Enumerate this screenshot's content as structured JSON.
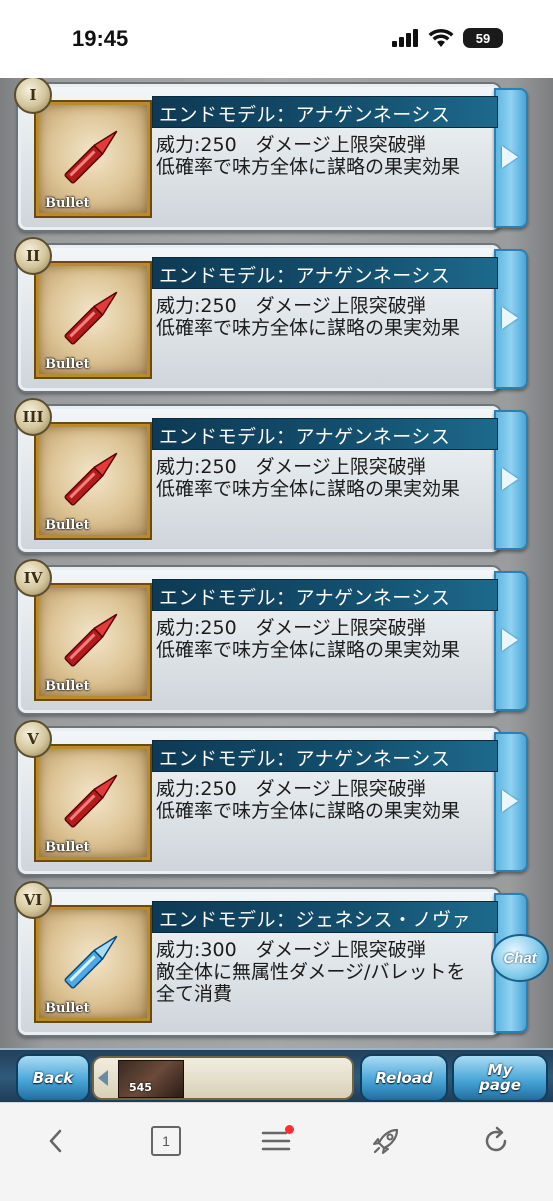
{
  "status_bar": {
    "time": "19:45",
    "battery": "59"
  },
  "cards": [
    {
      "numeral": "I",
      "name": "エンドモデル：アナゲンネーシス",
      "line1": "威力:250　ダメージ上限突破弾",
      "line2": "低確率で味方全体に謀略の果実効果",
      "line3": "",
      "item_label": "Bullet",
      "bullet_color": "red"
    },
    {
      "numeral": "II",
      "name": "エンドモデル：アナゲンネーシス",
      "line1": "威力:250　ダメージ上限突破弾",
      "line2": "低確率で味方全体に謀略の果実効果",
      "line3": "",
      "item_label": "Bullet",
      "bullet_color": "red"
    },
    {
      "numeral": "III",
      "name": "エンドモデル：アナゲンネーシス",
      "line1": "威力:250　ダメージ上限突破弾",
      "line2": "低確率で味方全体に謀略の果実効果",
      "line3": "",
      "item_label": "Bullet",
      "bullet_color": "red"
    },
    {
      "numeral": "IV",
      "name": "エンドモデル：アナゲンネーシス",
      "line1": "威力:250　ダメージ上限突破弾",
      "line2": "低確率で味方全体に謀略の果実効果",
      "line3": "",
      "item_label": "Bullet",
      "bullet_color": "red"
    },
    {
      "numeral": "V",
      "name": "エンドモデル：アナゲンネーシス",
      "line1": "威力:250　ダメージ上限突破弾",
      "line2": "低確率で味方全体に謀略の果実効果",
      "line3": "",
      "item_label": "Bullet",
      "bullet_color": "red"
    },
    {
      "numeral": "VI",
      "name": "エンドモデル：ジェネシス・ノヴァ",
      "line1": "威力:300　ダメージ上限突破弾",
      "line2": "敵全体に無属性ダメージ/バレットを",
      "line3": "全て消費",
      "item_label": "Bullet",
      "bullet_color": "blue"
    }
  ],
  "chat_button": "Chat",
  "game_nav": {
    "back": "Back",
    "reload": "Reload",
    "mypage_line1": "My",
    "mypage_line2": "page",
    "mini_number": "545"
  },
  "toolbar": {
    "tab_count": "1"
  },
  "icons": [
    "signal-icon",
    "wifi-icon",
    "battery-icon",
    "arrow-right-icon",
    "back-chevron-icon",
    "tabs-icon",
    "menu-icon",
    "rocket-icon",
    "refresh-icon"
  ]
}
